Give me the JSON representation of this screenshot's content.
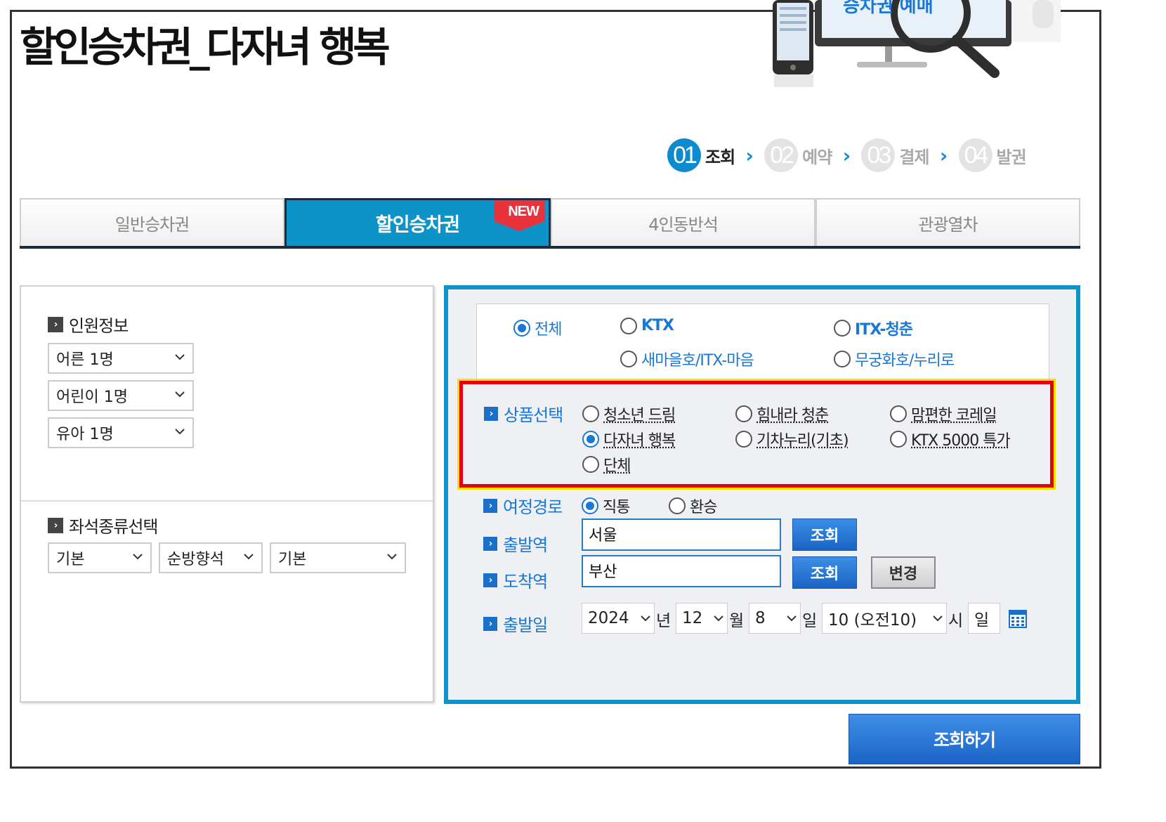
{
  "page": {
    "title": "할인승차권_다자녀 행복",
    "hero_text": "승차권 예매"
  },
  "steps": [
    {
      "num": "01",
      "label": "조회",
      "active": true
    },
    {
      "num": "02",
      "label": "예약",
      "active": false
    },
    {
      "num": "03",
      "label": "결제",
      "active": false
    },
    {
      "num": "04",
      "label": "발권",
      "active": false
    }
  ],
  "tabs": {
    "general": "일반승차권",
    "discount": "할인승차권",
    "discount_badge": "NEW",
    "four_seat": "4인동반석",
    "tour": "관광열차"
  },
  "passengers": {
    "label": "인원정보",
    "adult": "어른 1명",
    "child": "어린이 1명",
    "infant": "유아 1명"
  },
  "seat": {
    "label": "좌석종류선택",
    "option1": "기본",
    "option2": "순방향석",
    "option3": "기본"
  },
  "train_types": {
    "all": "전체",
    "ktx": "KTX",
    "itx_cheongchun": "ITX-청춘",
    "saemaeul": "새마을호/ITX-마음",
    "mugunghwa": "무궁화호/누리로",
    "selected": "전체"
  },
  "products": {
    "label": "상품선택",
    "youth_dream": "청소년 드림",
    "cheer_youth": "힘내라 청춘",
    "comfort_korail": "맘편한 코레일",
    "multi_child": "다자녀 행복",
    "gichanuri": "기차누리(기초)",
    "ktx5000": "KTX 5000 특가",
    "group": "단체",
    "selected": "다자녀 행복"
  },
  "route": {
    "label": "여정경로",
    "direct": "직통",
    "transfer": "환승",
    "selected": "직통"
  },
  "departure": {
    "label": "출발역",
    "value": "서울",
    "button": "조회"
  },
  "arrival": {
    "label": "도착역",
    "value": "부산",
    "button": "조회",
    "swap": "변경"
  },
  "date": {
    "label": "출발일",
    "year": "2024",
    "year_unit": "년",
    "month": "12",
    "month_unit": "월",
    "day": "8",
    "day_unit": "일",
    "hour": "10 (오전10)",
    "hour_unit": "시",
    "weekday": "일"
  },
  "submit": "조회하기",
  "colors": {
    "accent": "#0e93c8",
    "link_blue": "#1a78d4",
    "highlight_red": "#e4000f",
    "highlight_yellow": "#f5e000"
  }
}
